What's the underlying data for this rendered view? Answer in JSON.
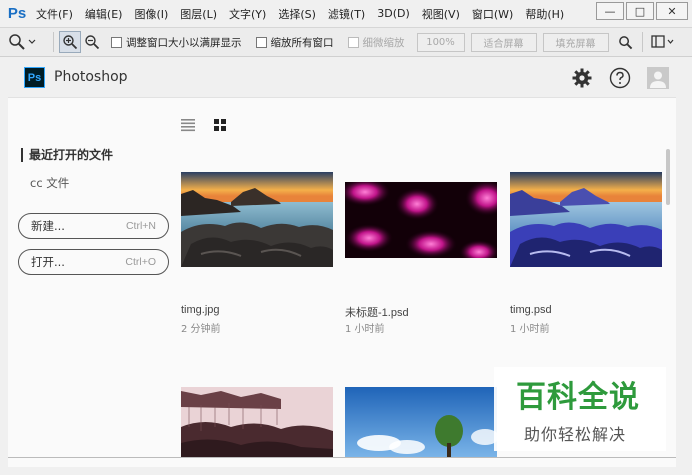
{
  "menubar": {
    "logo": "Ps",
    "items": [
      "文件(F)",
      "编辑(E)",
      "图像(I)",
      "图层(L)",
      "文字(Y)",
      "选择(S)",
      "滤镜(T)",
      "3D(D)",
      "视图(V)",
      "窗口(W)",
      "帮助(H)"
    ],
    "window_controls": {
      "minimize": "—",
      "maximize": "□",
      "close": "✕"
    }
  },
  "options_bar": {
    "resize_windows_label": "调整窗口大小以满屏显示",
    "zoom_all_label": "缩放所有窗口",
    "scrubby_zoom_label": "细微缩放",
    "zoom_100": "100%",
    "fit_screen": "适合屏幕",
    "fill_screen": "填充屏幕"
  },
  "start": {
    "app_badge": "Ps",
    "app_name": "Photoshop",
    "recent_files_label": "最近打开的文件",
    "cc_files_label": "cc 文件",
    "new_button": {
      "label": "新建...",
      "shortcut": "Ctrl+N"
    },
    "open_button": {
      "label": "打开...",
      "shortcut": "Ctrl+O"
    },
    "files": [
      {
        "name": "timg.jpg",
        "time": "2 分钟前"
      },
      {
        "name": "未标题-1.psd",
        "time": "1 小时前"
      },
      {
        "name": "timg.psd",
        "time": "1 小时前"
      }
    ]
  },
  "watermark": {
    "title": "百科全说",
    "subtitle": "助你轻松解决"
  },
  "colors": {
    "ps_blue": "#31a8ff",
    "ps_dark": "#001d26",
    "watermark_green": "#2e9a3c"
  }
}
